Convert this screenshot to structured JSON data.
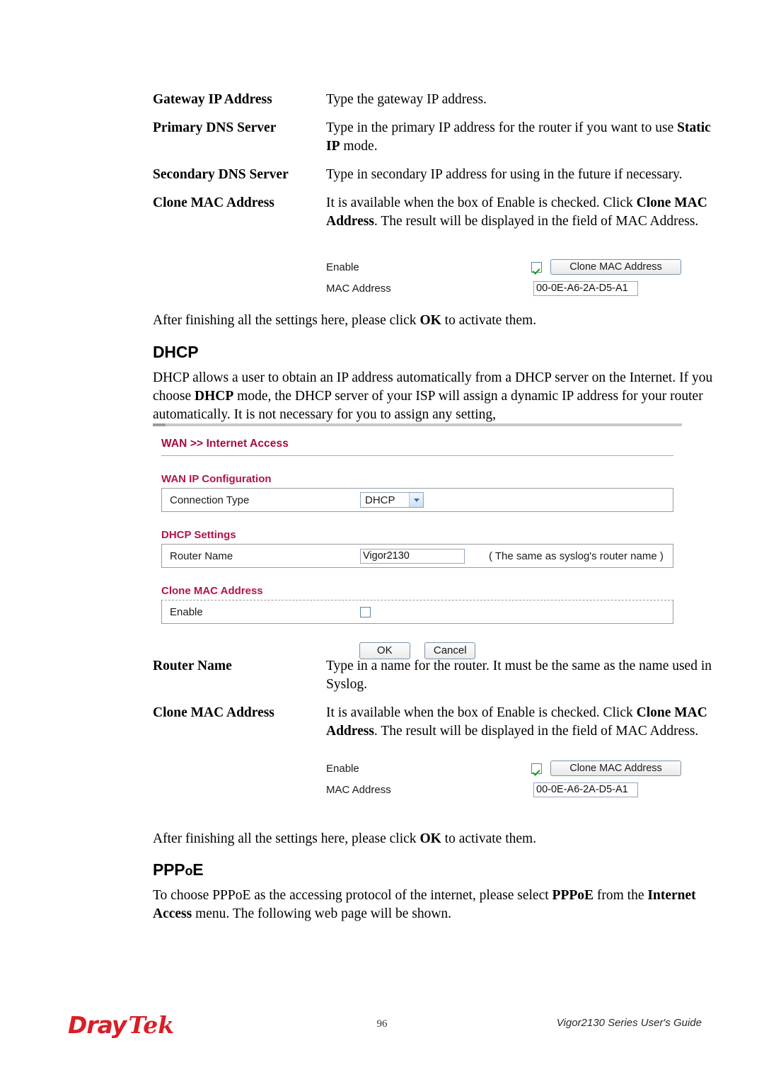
{
  "definitions_top": [
    {
      "term": "Gateway IP Address",
      "desc_html": "Type the gateway IP address."
    },
    {
      "term": "Primary DNS Server",
      "desc_html": "Type in the primary IP address for the router if you want to use <b>Static IP</b> mode."
    },
    {
      "term": "Secondary DNS Server",
      "desc_html": "Type in secondary IP address for using in the future if necessary."
    },
    {
      "term": "Clone MAC Address",
      "desc_html": "It is available when the box of Enable is checked. Click <b>Clone MAC Address</b>. The result will be displayed in the field of MAC Address."
    }
  ],
  "clone_fig_top": {
    "enable_label": "Enable",
    "mac_label": "MAC Address",
    "button_label": "Clone MAC Address",
    "mac_value": "00-0E-A6-2A-D5-A1",
    "enable_checked": "checked"
  },
  "after_settings_1": "After finishing all the settings here, please click <b>OK</b> to activate them.",
  "dhcp_heading": "DHCP",
  "dhcp_paragraph": "DHCP allows a user to obtain an IP address automatically from a DHCP server on the Internet. If you choose <b>DHCP</b> mode, the DHCP server of your ISP will assign a dynamic IP address for your router automatically. It is not necessary for you to assign any setting,",
  "router_panel": {
    "breadcrumb": "WAN >> Internet Access",
    "wan_ip_config_title": "WAN IP Configuration",
    "connection_type_label": "Connection Type",
    "connection_type_value": "DHCP",
    "dhcp_settings_title": "DHCP Settings",
    "router_name_label": "Router Name",
    "router_name_value": "Vigor2130",
    "router_name_hint": "( The same as syslog's router name )",
    "clone_mac_title": "Clone MAC Address",
    "enable_label": "Enable",
    "ok_label": "OK",
    "cancel_label": "Cancel",
    "accent_color": "#b4134a"
  },
  "definitions_bottom": [
    {
      "term": "Router Name",
      "desc_html": "Type in a name for the router. It must be the same as the name used in Syslog."
    },
    {
      "term": "Clone MAC Address",
      "desc_html": "It is available when the box of Enable is checked. Click <b>Clone MAC Address</b>. The result will be displayed in the field of MAC Address."
    }
  ],
  "clone_fig_bottom": {
    "enable_label": "Enable",
    "mac_label": "MAC Address",
    "button_label": "Clone MAC Address",
    "mac_value": "00-0E-A6-2A-D5-A1",
    "enable_checked": "checked"
  },
  "after_settings_2": "After finishing all the settings here, please click <b>OK</b> to activate them.",
  "pppoe_heading_main": "PPP",
  "pppoe_heading_small": "o",
  "pppoe_heading_tail": "E",
  "pppoe_paragraph": "To choose PPPoE as the accessing protocol of the internet, please select <b>PPPoE</b> from the <b>Internet Access</b> menu. The following web page will be shown.",
  "footer": {
    "logo_part1": "Dray",
    "logo_part2": "Tek",
    "page_number": "96",
    "guide_text": "Vigor2130 Series User's Guide"
  }
}
